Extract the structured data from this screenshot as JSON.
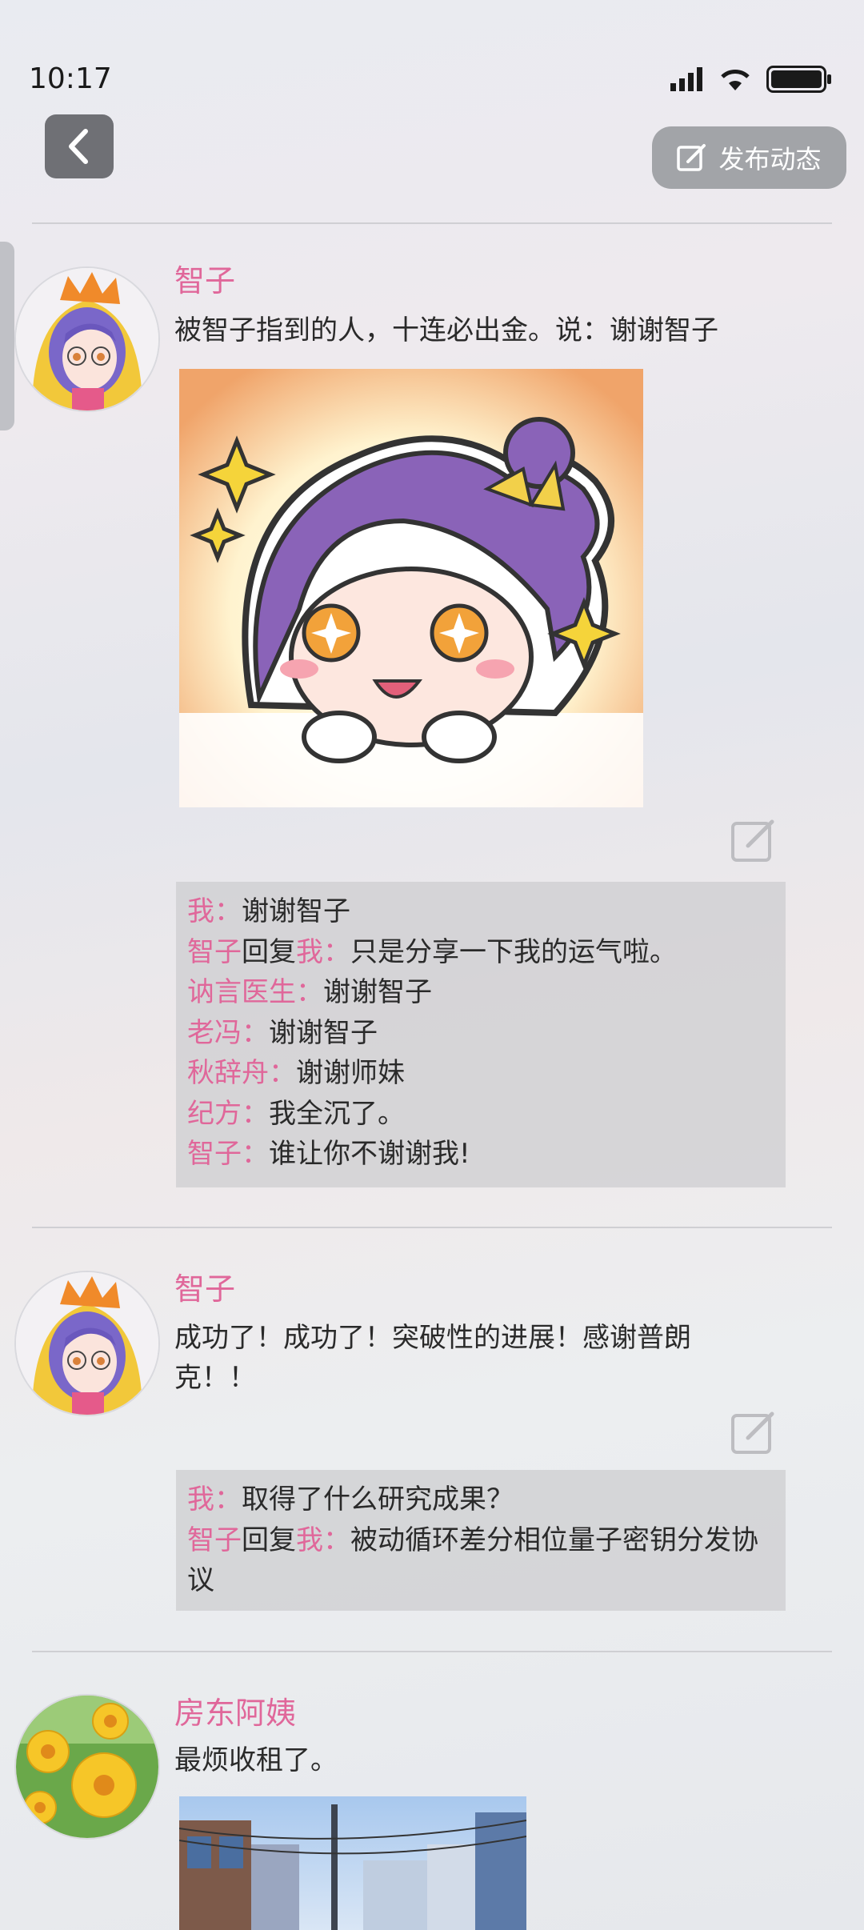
{
  "status": {
    "time": "10:17"
  },
  "header": {
    "publish_label": "发布动态"
  },
  "colors": {
    "name_pink": "#e0679a",
    "comment_bg": "#cdcdd0",
    "button_gray": "#a2a4a8"
  },
  "posts": [
    {
      "author": "智子",
      "text": "被智子指到的人，十连必出金。说：谢谢智子",
      "has_image": true,
      "comments": [
        {
          "author": "我",
          "sep": "：",
          "text": "谢谢智子"
        },
        {
          "author": "智子",
          "reply_word": "回复",
          "target": "我",
          "sep": "：",
          "text": "只是分享一下我的运气啦。"
        },
        {
          "author": "讷言医生",
          "sep": "：",
          "text": "谢谢智子"
        },
        {
          "author": "老冯",
          "sep": "：",
          "text": "谢谢智子"
        },
        {
          "author": "秋辞舟",
          "sep": "：",
          "text": "谢谢师妹"
        },
        {
          "author": "纪方",
          "sep": "：",
          "text": "我全沉了。"
        },
        {
          "author": "智子",
          "sep": "：",
          "text": "谁让你不谢谢我!"
        }
      ]
    },
    {
      "author": "智子",
      "text": "成功了！成功了！突破性的进展！感谢普朗克！！",
      "comments": [
        {
          "author": "我",
          "sep": "：",
          "text": "取得了什么研究成果？"
        },
        {
          "author": "智子",
          "reply_word": "回复",
          "target": "我",
          "sep": "：",
          "text": "被动循环差分相位量子密钥分发协议"
        }
      ]
    },
    {
      "author": "房东阿姨",
      "text": "最烦收租了。",
      "has_image": true
    }
  ]
}
